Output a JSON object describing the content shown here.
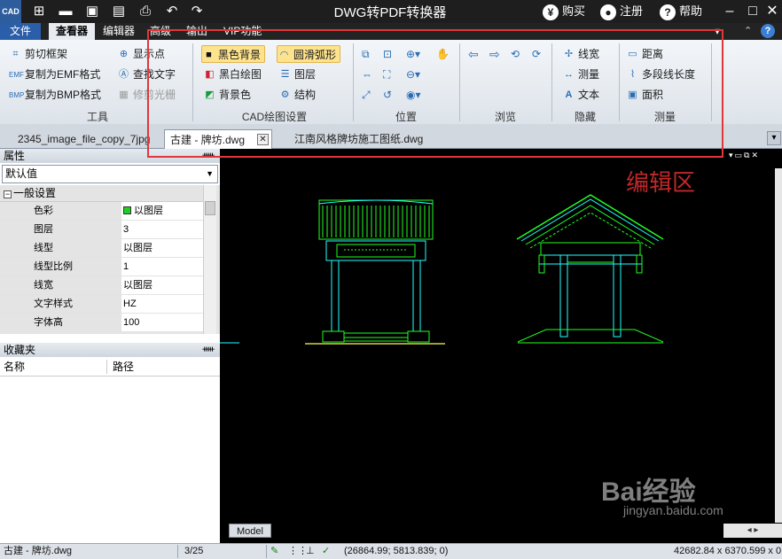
{
  "app": {
    "title": "DWG转PDF转换器",
    "logo": "CAD"
  },
  "titlebar": {
    "buy": "购买",
    "register": "注册",
    "help": "帮助",
    "buy_icon": "¥",
    "register_icon": "👤",
    "help_icon": "?"
  },
  "menu": {
    "file": "文件",
    "viewer": "查看器",
    "editor": "编辑器",
    "advanced": "高级",
    "output": "输出",
    "vip": "VIP功能"
  },
  "ribbon": {
    "tools": {
      "label": "工具",
      "clip": "剪切框架",
      "copy_emf": "复制为EMF格式",
      "copy_bmp": "复制为BMP格式",
      "show_points": "显示点",
      "find_text": "查找文字",
      "trim_raster": "修剪光栅"
    },
    "cad": {
      "label": "CAD绘图设置",
      "black_bg": "黑色背景",
      "smooth_arc": "圆滑弧形",
      "bw_drawing": "黑白绘图",
      "layers": "图层",
      "bg_color": "背景色",
      "structure": "结构"
    },
    "position": {
      "label": "位置"
    },
    "browse": {
      "label": "浏览"
    },
    "hide": {
      "label": "隐藏",
      "linewidth": "线宽",
      "measure": "测量",
      "text": "文本"
    },
    "measure": {
      "label": "测量",
      "distance": "距离",
      "polyline_length": "多段线长度",
      "area": "面积"
    }
  },
  "tabs": [
    "2345_image_file_copy_7jpg",
    "古建 - 牌坊.dwg",
    "江南风格牌坊施工图纸.dwg"
  ],
  "properties": {
    "title": "属性",
    "default": "默认值",
    "section": "一般设置",
    "rows": [
      {
        "name": "色彩",
        "value": "以图层"
      },
      {
        "name": "图层",
        "value": "3"
      },
      {
        "name": "线型",
        "value": "以图层"
      },
      {
        "name": "线型比例",
        "value": "1"
      },
      {
        "name": "线宽",
        "value": "以图层"
      },
      {
        "name": "文字样式",
        "value": "HZ"
      },
      {
        "name": "字体高",
        "value": "100"
      }
    ]
  },
  "favorites": {
    "title": "收藏夹",
    "col_name": "名称",
    "col_path": "路径"
  },
  "canvas": {
    "annotation": "编辑区",
    "model_tab": "Model",
    "watermark_brand": "Bai经验",
    "watermark_url": "jingyan.baidu.com"
  },
  "status": {
    "file": "古建 - 牌坊.dwg",
    "page": "3/25",
    "coords": "(26864.99; 5813.839; 0)",
    "size": "42682.84 x 6370.599 x 0"
  },
  "colors": {
    "annotation": "#c0282a",
    "highlight": "#e0373b",
    "cad_green": "#22ff22",
    "cad_cyan": "#22ffff",
    "cad_yellow": "#ffff44"
  }
}
